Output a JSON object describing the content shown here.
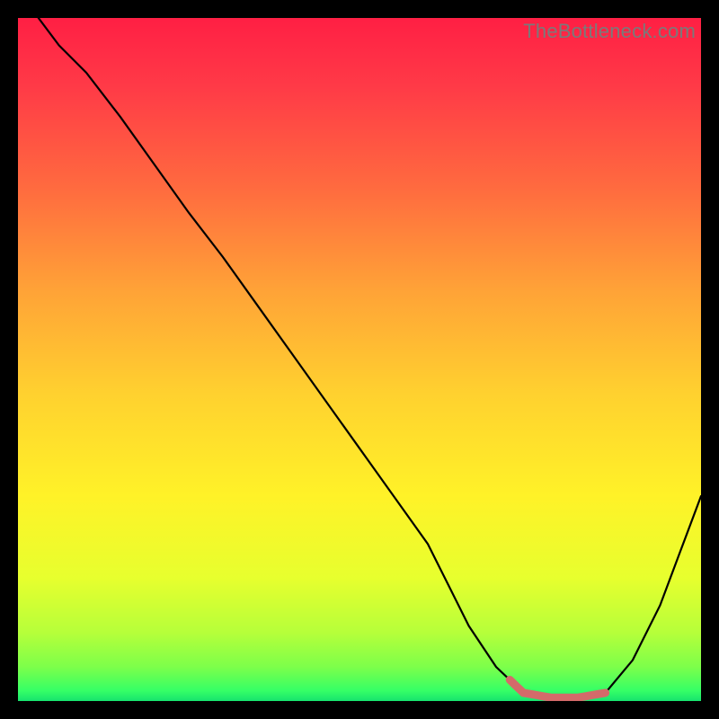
{
  "watermark": "TheBottleneck.com",
  "colors": {
    "frame": "#000000",
    "curve": "#000000",
    "highlight": "#d46a6a",
    "gradient_stops": [
      {
        "offset": 0.0,
        "color": "#ff1f44"
      },
      {
        "offset": 0.1,
        "color": "#ff3a47"
      },
      {
        "offset": 0.25,
        "color": "#ff6b3f"
      },
      {
        "offset": 0.4,
        "color": "#ffa337"
      },
      {
        "offset": 0.55,
        "color": "#ffd12f"
      },
      {
        "offset": 0.7,
        "color": "#fff228"
      },
      {
        "offset": 0.82,
        "color": "#e7ff2e"
      },
      {
        "offset": 0.9,
        "color": "#b6ff3a"
      },
      {
        "offset": 0.95,
        "color": "#7dff4a"
      },
      {
        "offset": 0.985,
        "color": "#35ff66"
      },
      {
        "offset": 1.0,
        "color": "#16e36e"
      }
    ]
  },
  "chart_data": {
    "type": "line",
    "title": "",
    "xlabel": "",
    "ylabel": "",
    "xlim": [
      0,
      100
    ],
    "ylim": [
      0,
      100
    ],
    "series": [
      {
        "name": "bottleneck-curve",
        "x": [
          3,
          6,
          10,
          15,
          20,
          25,
          30,
          35,
          40,
          45,
          50,
          55,
          60,
          63,
          66,
          70,
          74,
          78,
          82,
          86,
          90,
          94,
          97,
          100
        ],
        "values": [
          100,
          96,
          92,
          85.5,
          78.5,
          71.5,
          65,
          58,
          51,
          44,
          37,
          30,
          23,
          17,
          11,
          5,
          1.2,
          0.5,
          0.5,
          1.2,
          6,
          14,
          22,
          30
        ]
      }
    ],
    "annotations": [
      {
        "name": "optimal-flat-region",
        "x_start": 72,
        "x_end": 86,
        "y": 0.8
      }
    ]
  }
}
